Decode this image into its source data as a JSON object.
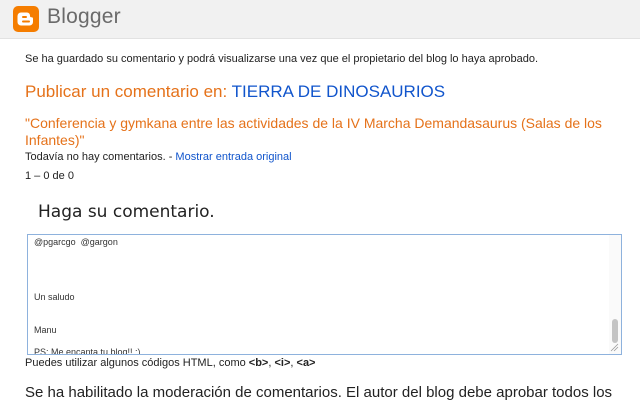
{
  "header": {
    "brand": "Blogger",
    "logo_icon": "blogger-logo-icon",
    "logo_color": "#f57d00"
  },
  "saved_message": "Se ha guardado su comentario y podrá visualizarse una vez que el propietario del blog lo haya aprobado.",
  "publish": {
    "prefix": "Publicar un comentario en: ",
    "blog_name": "TIERRA DE DINOSAURIOS"
  },
  "post_title": "\"Conferencia y gymkana entre las actividades de la IV Marcha Demandasaurus (Salas de los Infantes)\"",
  "no_comments": {
    "text": "Todavía no hay comentarios. - ",
    "link": "Mostrar entrada original"
  },
  "pagination": "1 – 0 de 0",
  "comment_form": {
    "heading": "Haga su comentario.",
    "lines": [
      "@pgarcgo  @gargon",
      "",
      "",
      "",
      "",
      "Un saludo",
      "",
      "",
      "Manu",
      "",
      "PS: Me encanta tu blog!! ;)"
    ]
  },
  "html_hint": {
    "prefix": "Puedes utilizar algunos códigos HTML, como ",
    "codes": [
      "<b>",
      "<i>",
      "<a>"
    ]
  },
  "moderation_notice": "Se ha habilitado la moderación de comentarios. El autor del blog debe aprobar todos los",
  "colors": {
    "accent_orange": "#e5721a",
    "link_blue": "#1155cc",
    "textarea_border": "#8eb2dd"
  }
}
